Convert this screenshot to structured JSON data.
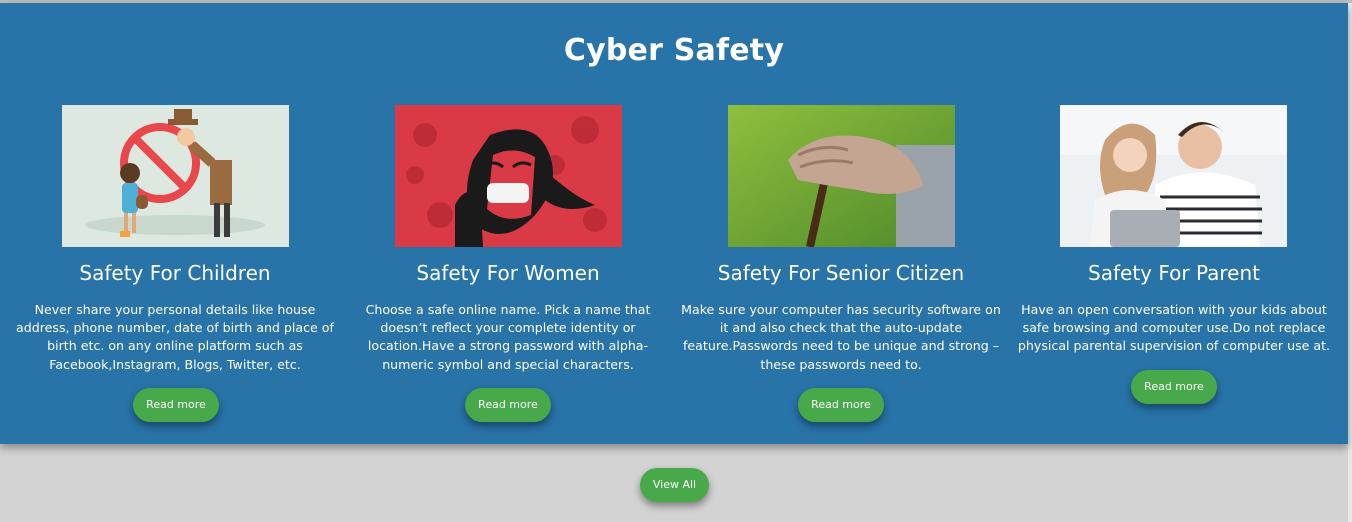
{
  "section": {
    "title": "Cyber Safety"
  },
  "cards": [
    {
      "image_icon": "child-safety-image",
      "title": "Safety For Children",
      "description": "Never share your personal details like house address, phone number, date of birth and place of birth etc. on any online platform such as Facebook,Instagram, Blogs, Twitter, etc.",
      "button": "Read more"
    },
    {
      "image_icon": "women-safety-image",
      "title": "Safety For Women",
      "description": "Choose a safe online name. Pick a name that doesn’t reflect your complete identity or location.Have a strong password with alpha-numeric symbol and special characters.",
      "button": "Read more"
    },
    {
      "image_icon": "senior-citizen-image",
      "title": "Safety For Senior Citizen",
      "description": "Make sure your computer has security software on it and also check that the auto-update feature.Passwords need to be unique and strong – these passwords need to.",
      "button": "Read more"
    },
    {
      "image_icon": "parent-child-image",
      "title": "Safety For Parent",
      "description": "Have an open conversation with your kids about safe browsing and computer use.Do not replace physical parental supervision of computer use at.",
      "button": "Read more"
    }
  ],
  "view_all": "View All",
  "colors": {
    "panel": "#2873a8",
    "button": "#48a94a",
    "page_bg": "#d3d3d3"
  }
}
